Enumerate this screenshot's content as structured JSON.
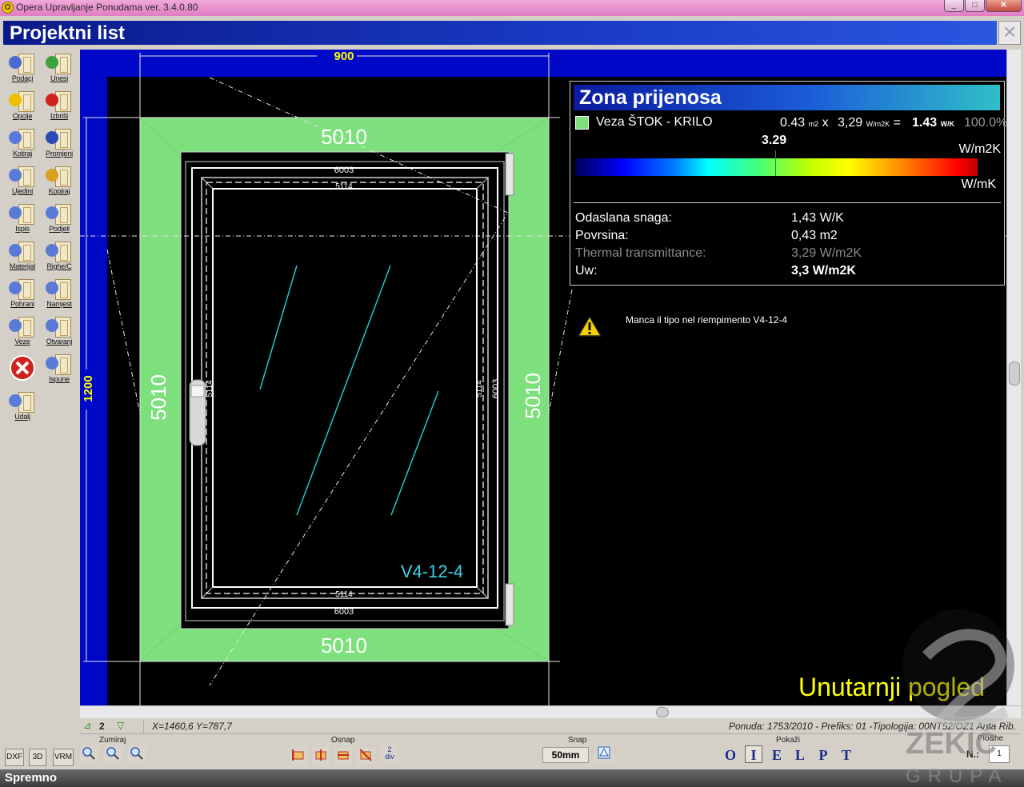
{
  "window": {
    "title": "Opera Upravljanje Ponudama ver. 3.4.0.80",
    "min": "_",
    "max": "□",
    "close": "✕"
  },
  "header": {
    "title": "Projektni list",
    "close": "×"
  },
  "toolbar": [
    {
      "label": "Podaçi",
      "icon": "clock-icon"
    },
    {
      "label": "Unesi",
      "icon": "add-icon"
    },
    {
      "label": "Opcije",
      "icon": "star-icon"
    },
    {
      "label": "Izbriši",
      "icon": "delete-icon"
    },
    {
      "label": "Kotiraj",
      "icon": "dimension-icon"
    },
    {
      "label": "Promjeni",
      "icon": "change-icon"
    },
    {
      "label": "Ujedini",
      "icon": "merge-icon"
    },
    {
      "label": "Kopiraj",
      "icon": "copy-icon"
    },
    {
      "label": "Ispis",
      "icon": "print-icon"
    },
    {
      "label": "Podjeli",
      "icon": "split-icon"
    },
    {
      "label": "Materijal",
      "icon": "material-icon"
    },
    {
      "label": "Righe/C",
      "icon": "grid-icon"
    },
    {
      "label": "Pohrani",
      "icon": "save-icon"
    },
    {
      "label": "Namjest",
      "icon": "adjust-icon"
    },
    {
      "label": "Veze",
      "icon": "joint-icon"
    },
    {
      "label": "Otvaranj",
      "icon": "opening-icon"
    },
    {
      "label": "",
      "icon": "exit-icon"
    },
    {
      "label": "Ispune",
      "icon": "fill-icon"
    },
    {
      "label": "Udalj",
      "icon": "ruler-icon"
    }
  ],
  "drawing": {
    "dim_width": "900",
    "dim_height": "1200",
    "frame_top": "5010",
    "frame_bottom": "5010",
    "frame_left": "5010",
    "frame_right": "5010",
    "sash_top_outer": "6003",
    "sash_top_inner": "5114",
    "sash_bottom_inner": "5114",
    "sash_bottom_outer": "6003",
    "sash_left": "5114",
    "sash_right_inner": "5114",
    "sash_right_outer": "6003",
    "glass_label": "V4-12-4",
    "frame_color": "#7de07d"
  },
  "info": {
    "zone_title": "Zona prijenosa",
    "zone_name": "Veza ŠTOK - KRILO",
    "zone_area": "0.43",
    "zone_area_unit": "m2",
    "zone_x": "x",
    "zone_u": "3,29",
    "zone_u_unit": "W/m2K",
    "zone_eq": "=",
    "zone_total": "1.43",
    "zone_total_unit": "W/K",
    "zone_pct": "100.0%",
    "marker_value": "3.29",
    "scale_unit_top": "W/m2K",
    "scale_unit_bottom": "W/mK",
    "props": [
      {
        "key": "Odaslana snaga:",
        "value": "1,43 W/K",
        "style": "normal"
      },
      {
        "key": "Povrsina:",
        "value": "0,43 m2",
        "style": "normal"
      },
      {
        "key": "Thermal transmittance:",
        "value": "3,29 W/m2K",
        "style": "dim"
      },
      {
        "key": "Uw:",
        "value": "3,3 W/m2K",
        "style": "bold"
      }
    ]
  },
  "warning": "Manca il tipo nel riempimento V4-12-4",
  "view_label": "Unutarnji pogled",
  "status_row": {
    "rot_value": "2",
    "coords": "X=1460,6  Y=787,7",
    "offer": "Ponuda: 1753/2010 - Prefiks: 01 -Tipologija: 00NT52/OZ1 Anta Rib."
  },
  "bottom": {
    "export_buttons": [
      "DXF",
      "3D",
      "VRM"
    ],
    "zoom_label": "Zumiraj",
    "snap_group_label": "Osnap",
    "snap_label": "Snap",
    "snap_value": "50mm",
    "div_label": "2\ndiv",
    "show_label": "Pokaži",
    "show_letters": [
      "O",
      "I",
      "E",
      "L",
      "P",
      "T"
    ],
    "show_active": 1,
    "plohe_label": "Plo&he",
    "n_label": "N.:",
    "n_value": "1"
  },
  "statusbar": "Spremno",
  "watermark": {
    "line1": "ZEKIĆ",
    "line2": "GRUPA"
  }
}
